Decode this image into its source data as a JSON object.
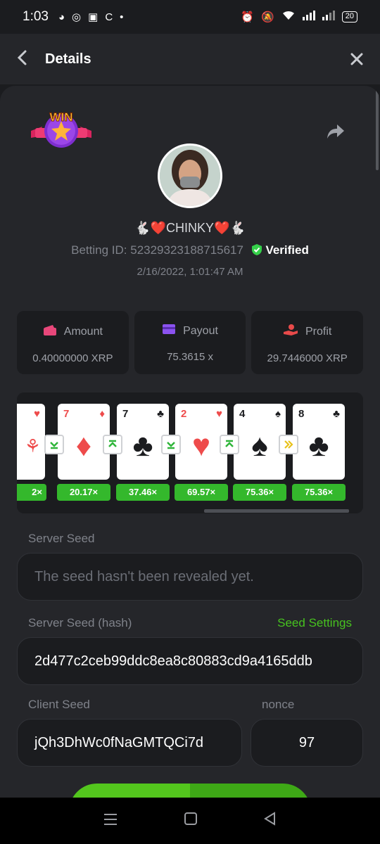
{
  "status_bar": {
    "time": "1:03",
    "battery": "20"
  },
  "header": {
    "title": "Details"
  },
  "badge": {
    "text": "WIN"
  },
  "user": {
    "name": "🐇❤️CHINKY❤️🐇"
  },
  "bet": {
    "betting_id_label": "Betting ID: ",
    "betting_id": "52329323188715617",
    "verified_label": "Verified",
    "date": "2/16/2022, 1:01:47 AM"
  },
  "stats": [
    {
      "label": "Amount",
      "value": "0.40000000 XRP",
      "icon": "wallet-icon",
      "icon_color": "#e8477a"
    },
    {
      "label": "Payout",
      "value": "75.3615 x",
      "icon": "card-icon",
      "icon_color": "#8b52f0"
    },
    {
      "label": "Profit",
      "value": "29.7446000 XRP",
      "icon": "hand-coin-icon",
      "icon_color": "#e84a4a"
    }
  ],
  "cards": [
    {
      "rank": "",
      "suit": "♥",
      "color": "red"
    },
    {
      "rank": "7",
      "suit": "♦",
      "color": "red"
    },
    {
      "rank": "7",
      "suit": "♣",
      "color": "black"
    },
    {
      "rank": "2",
      "suit": "♥",
      "color": "red"
    },
    {
      "rank": "4",
      "suit": "♠",
      "color": "black"
    },
    {
      "rank": "8",
      "suit": "♣",
      "color": "black"
    }
  ],
  "arrows": [
    "⌄",
    "⌃",
    "⌄",
    "⌃",
    "»"
  ],
  "multipliers": [
    "2×",
    "20.17×",
    "37.46×",
    "69.57×",
    "75.36×",
    "75.36×"
  ],
  "server_seed": {
    "label": "Server Seed",
    "value": "The seed hasn't been revealed yet."
  },
  "server_seed_hash": {
    "label": "Server Seed (hash)",
    "link": "Seed Settings",
    "value": "2d477c2ceb99ddc8ea8c80883cd9a4165ddb"
  },
  "client_seed": {
    "label": "Client Seed",
    "value": "jQh3DhWc0fNaGMTQCi7d"
  },
  "nonce": {
    "label": "nonce",
    "value": "97"
  },
  "colors": {
    "accent_green": "#47c21f",
    "background": "#25262a"
  }
}
